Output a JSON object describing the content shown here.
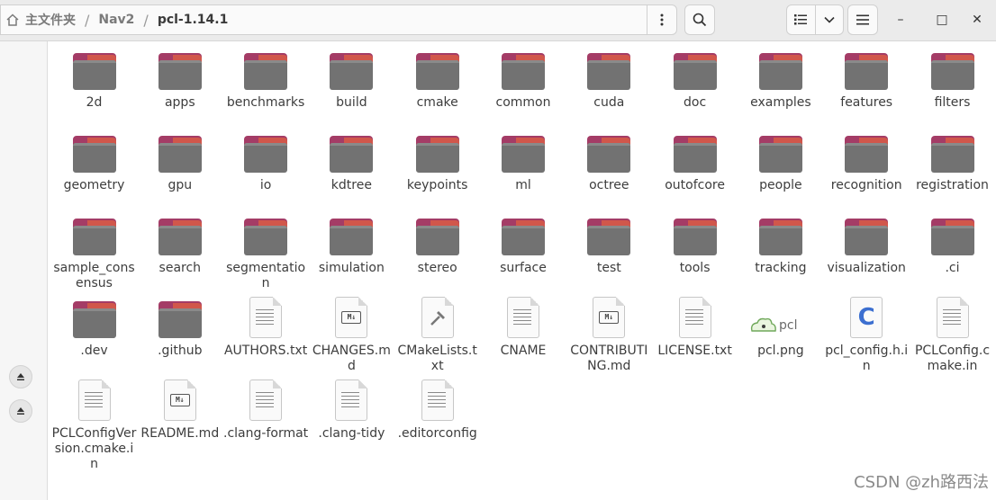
{
  "breadcrumb": {
    "home": "主文件夹",
    "parent": "Nav2",
    "current": "pcl-1.14.1",
    "separator": "/"
  },
  "toolbar": {
    "path_menu_icon": "kebab-vertical-icon",
    "search_icon": "search-icon",
    "view_icon": "list-view-icon",
    "view_dropdown_icon": "chevron-down-icon",
    "menu_icon": "hamburger-icon"
  },
  "window": {
    "minimize": "–",
    "maximize": "□",
    "close": "✕"
  },
  "colors": {
    "folder_body": "#727272",
    "folder_tab": "#a43c66",
    "folder_accent": "#d1574b",
    "c_file": "#3c6fd0"
  },
  "items": [
    {
      "label": "2d",
      "type": "folder"
    },
    {
      "label": "apps",
      "type": "folder"
    },
    {
      "label": "benchmarks",
      "type": "folder"
    },
    {
      "label": "build",
      "type": "folder"
    },
    {
      "label": "cmake",
      "type": "folder"
    },
    {
      "label": "common",
      "type": "folder"
    },
    {
      "label": "cuda",
      "type": "folder"
    },
    {
      "label": "doc",
      "type": "folder"
    },
    {
      "label": "examples",
      "type": "folder"
    },
    {
      "label": "features",
      "type": "folder"
    },
    {
      "label": "filters",
      "type": "folder"
    },
    {
      "label": "geometry",
      "type": "folder"
    },
    {
      "label": "gpu",
      "type": "folder"
    },
    {
      "label": "io",
      "type": "folder"
    },
    {
      "label": "kdtree",
      "type": "folder"
    },
    {
      "label": "keypoints",
      "type": "folder"
    },
    {
      "label": "ml",
      "type": "folder"
    },
    {
      "label": "octree",
      "type": "folder"
    },
    {
      "label": "outofcore",
      "type": "folder"
    },
    {
      "label": "people",
      "type": "folder"
    },
    {
      "label": "recognition",
      "type": "folder"
    },
    {
      "label": "registration",
      "type": "folder"
    },
    {
      "label": "sample_consensus",
      "type": "folder"
    },
    {
      "label": "search",
      "type": "folder"
    },
    {
      "label": "segmentation",
      "type": "folder"
    },
    {
      "label": "simulation",
      "type": "folder"
    },
    {
      "label": "stereo",
      "type": "folder"
    },
    {
      "label": "surface",
      "type": "folder"
    },
    {
      "label": "test",
      "type": "folder"
    },
    {
      "label": "tools",
      "type": "folder"
    },
    {
      "label": "tracking",
      "type": "folder"
    },
    {
      "label": "visualization",
      "type": "folder"
    },
    {
      "label": ".ci",
      "type": "folder"
    },
    {
      "label": ".dev",
      "type": "folder"
    },
    {
      "label": ".github",
      "type": "folder"
    },
    {
      "label": "AUTHORS.txt",
      "type": "text"
    },
    {
      "label": "CHANGES.md",
      "type": "markdown"
    },
    {
      "label": "CMakeLists.txt",
      "type": "cmake"
    },
    {
      "label": "CNAME",
      "type": "text"
    },
    {
      "label": "CONTRIBUTING.md",
      "type": "markdown"
    },
    {
      "label": "LICENSE.txt",
      "type": "text"
    },
    {
      "label": "pcl.png",
      "type": "image"
    },
    {
      "label": "pcl_config.h.in",
      "type": "c"
    },
    {
      "label": "PCLConfig.cmake.in",
      "type": "text"
    },
    {
      "label": "PCLConfigVersion.cmake.in",
      "type": "text"
    },
    {
      "label": "README.md",
      "type": "markdown"
    },
    {
      "label": ".clang-format",
      "type": "text"
    },
    {
      "label": ".clang-tidy",
      "type": "text"
    },
    {
      "label": ".editorconfig",
      "type": "text"
    }
  ],
  "watermark": "CSDN @zh路西法"
}
